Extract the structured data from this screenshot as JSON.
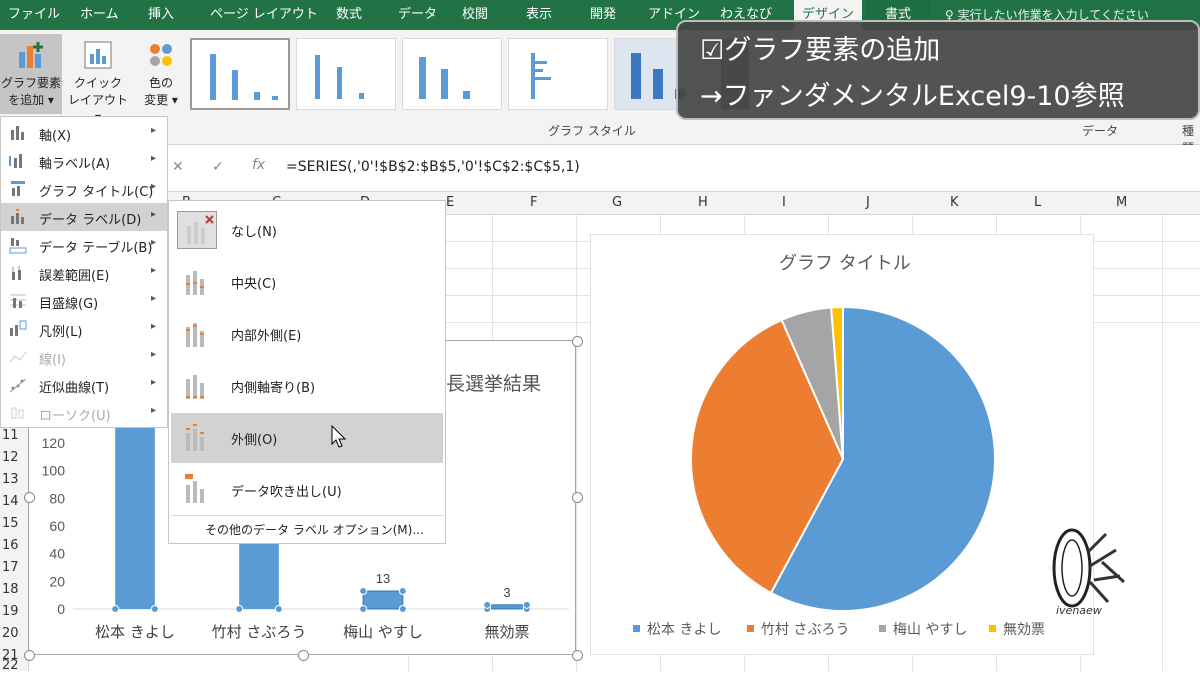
{
  "tabs": [
    "ファイル",
    "ホーム",
    "挿入",
    "ページ レイアウト",
    "数式",
    "データ",
    "校閲",
    "表示",
    "開発",
    "アドイン",
    "わえなび",
    "デザイン",
    "書式"
  ],
  "tell_me": "実行したい作業を入力してください",
  "ribbon": {
    "add_element_line1": "グラフ要素",
    "add_element_line2": "を追加 ▾",
    "quick_layout_line1": "クイック",
    "quick_layout_line2": "レイアウト ▾",
    "change_color_line1": "色の",
    "change_color_line2": "変更 ▾",
    "group_graph_style": "グラフ スタイル",
    "group_data": "データ",
    "group_type": "種類"
  },
  "formula_bar": {
    "formula": "=SERIES(,'0'!$B$2:$B$5,'0'!$C$2:$C$5,1)",
    "fx": "fx"
  },
  "columns": [
    "B",
    "C",
    "D",
    "E",
    "F",
    "G",
    "H",
    "I",
    "J",
    "K",
    "L",
    "M"
  ],
  "rows": [
    "11",
    "12",
    "13",
    "14",
    "15",
    "16",
    "17",
    "18",
    "19",
    "20",
    "21",
    "22"
  ],
  "menu": {
    "items": [
      {
        "label": "軸(X)",
        "arrow": "▸"
      },
      {
        "label": "軸ラベル(A)",
        "arrow": "▸"
      },
      {
        "label": "グラフ タイトル(C)",
        "arrow": "▸"
      },
      {
        "label": "データ ラベル(D)",
        "arrow": "▸"
      },
      {
        "label": "データ テーブル(B)",
        "arrow": "▸"
      },
      {
        "label": "誤差範囲(E)",
        "arrow": "▸"
      },
      {
        "label": "目盛線(G)",
        "arrow": "▸"
      },
      {
        "label": "凡例(L)",
        "arrow": "▸"
      },
      {
        "label": "線(I)",
        "arrow": "▸"
      },
      {
        "label": "近似曲線(T)",
        "arrow": "▸"
      },
      {
        "label": "ローソク(U)",
        "arrow": "▸"
      }
    ]
  },
  "submenu": {
    "items": [
      "なし(N)",
      "中央(C)",
      "内部外側(E)",
      "内側軸寄り(B)",
      "外側(O)",
      "データ吹き出し(U)"
    ],
    "more": "その他のデータ ラベル オプション(M)..."
  },
  "bar_chart": {
    "title_fragment": "会長選挙結果",
    "y_ticks": [
      "120",
      "100",
      "80",
      "60",
      "40",
      "20",
      "0"
    ],
    "chart_data": {
      "type": "bar",
      "categories": [
        "松本 きよし",
        "竹村 さぶろう",
        "梅山 やすし",
        "無効票"
      ],
      "data_labels": [
        "13",
        "3"
      ],
      "values": [
        140,
        140,
        13,
        3
      ],
      "ylim": [
        0,
        140
      ],
      "color": "#5b9bd5"
    }
  },
  "side_buttons": {
    "add": "✚",
    "style": "🖌",
    "filter": "▼"
  },
  "pie_chart": {
    "title": "グラフ タイトル",
    "chart_data": {
      "type": "pie",
      "labels": [
        "松本 きよし",
        "竹村 さぶろう",
        "梅山 やすし",
        "無効票"
      ],
      "values": [
        140,
        86,
        13,
        3
      ],
      "colors": [
        "#5b9bd5",
        "#ed7d31",
        "#a5a5a5",
        "#ffc000"
      ],
      "legend_position": "bottom"
    }
  },
  "overlay": {
    "line1": "☑グラフ要素の追加",
    "line2": "→ファンダメンタルExcel9-10参照"
  },
  "logo_text": "ivenaew"
}
